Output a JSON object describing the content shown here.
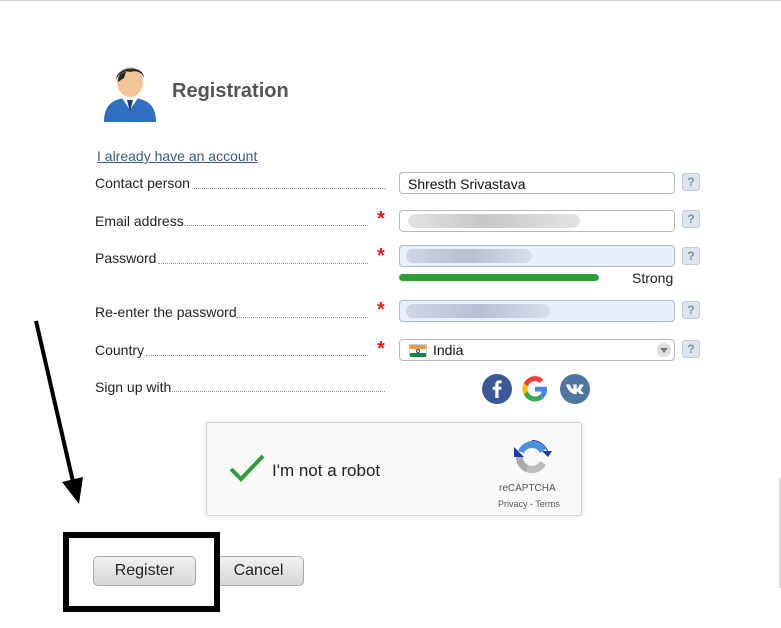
{
  "header": {
    "title": "Registration",
    "avatar_icon": "user-avatar-icon"
  },
  "login_link": "I already have an account",
  "form": {
    "contact_person": {
      "label": "Contact person",
      "value": "Shresth Srivastava",
      "help": "?"
    },
    "email": {
      "label": "Email address",
      "value": "",
      "required_mark": "*",
      "help": "?"
    },
    "password": {
      "label": "Password",
      "value": "",
      "required_mark": "*",
      "help": "?",
      "strength_label": "Strong",
      "strength_level": 1.0,
      "strength_color": "#2aa131"
    },
    "password_confirm": {
      "label": "Re-enter the password",
      "value": "",
      "required_mark": "*",
      "help": "?"
    },
    "country": {
      "label": "Country",
      "value": "India",
      "required_mark": "*",
      "help": "?",
      "flag_icon": "india-flag-icon"
    },
    "sign_up_with": {
      "label": "Sign up with",
      "providers": [
        "facebook-icon",
        "google-icon",
        "vk-icon"
      ]
    }
  },
  "captcha": {
    "label": "I'm not a robot",
    "brand": "reCAPTCHA",
    "privacy": "Privacy",
    "separator": "-",
    "terms": "Terms",
    "checked": true,
    "check_color": "#2e9e3a"
  },
  "buttons": {
    "register": "Register",
    "cancel": "Cancel"
  },
  "colors": {
    "required": "#e02020",
    "link": "#3a5a8c",
    "facebook": "#3b5998",
    "vk": "#4e76a1"
  }
}
